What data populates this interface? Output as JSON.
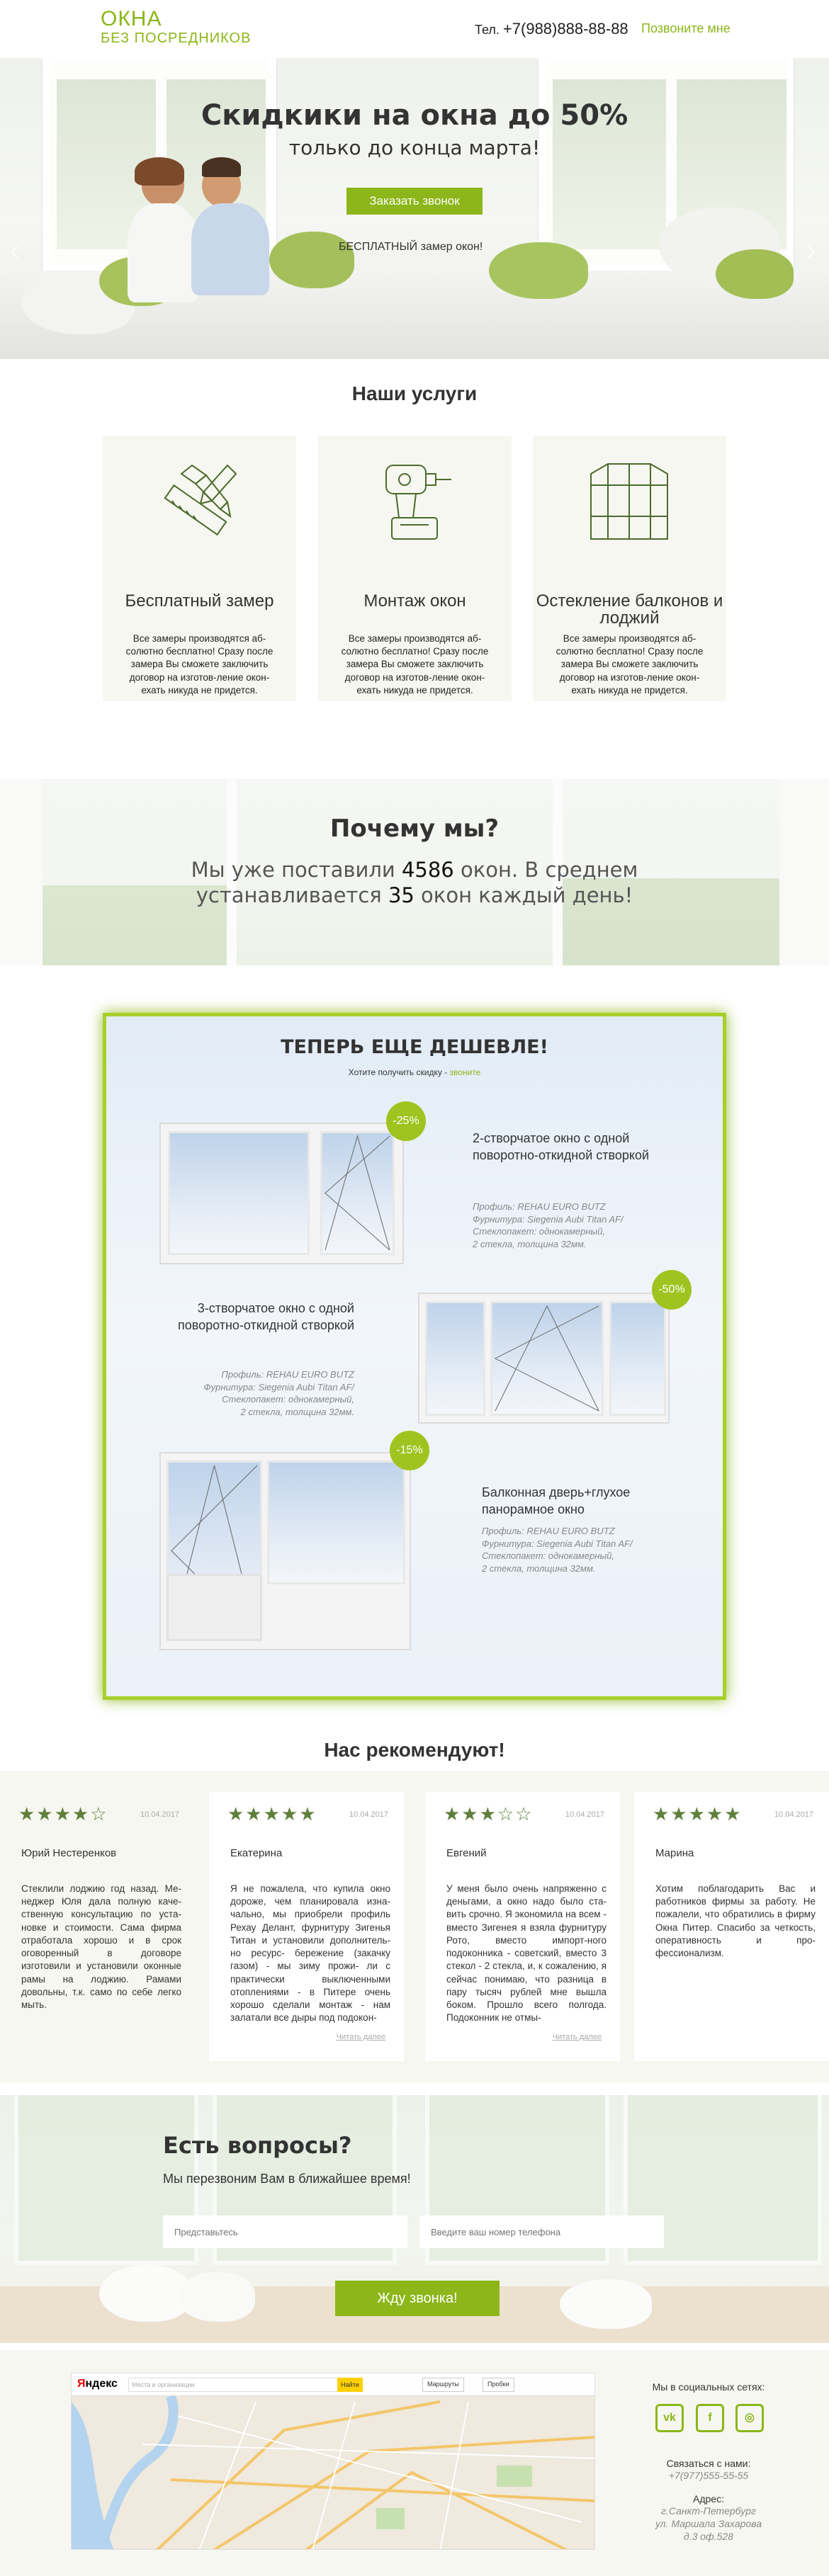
{
  "header": {
    "logo_line1": "ОКНА",
    "logo_line2": "БЕЗ ПОСРЕДНИКОВ",
    "phone_label": "Тел.",
    "phone_number": "+7(988)888-88-88",
    "callme_label": "Позвоните мне"
  },
  "hero": {
    "title": "Скидкики на окна до 50%",
    "subtitle": "только до конца марта!",
    "button_label": "Заказать звонок",
    "free_measure": "БЕСПЛАТНЫЙ замер окон!",
    "arrow_left": "‹",
    "arrow_right": "›"
  },
  "services": {
    "title": "Наши услуги",
    "items": [
      {
        "title": "Бесплатный замер",
        "desc": "Все замеры производятся аб-солютно бесплатно! Сразу после замера Вы сможете заключить договор на изготов-ление окон-ехать никуда не придется."
      },
      {
        "title": "Монтаж окон",
        "desc": "Все замеры производятся аб-солютно бесплатно! Сразу после замера Вы сможете заключить договор на изготов-ление окон-ехать никуда не придется."
      },
      {
        "title": "Остекление балконов и лоджий",
        "desc": "Все замеры производятся аб-солютно бесплатно! Сразу после замера Вы сможете заключить договор на изготов-ление окон-ехать никуда не придется."
      }
    ]
  },
  "why": {
    "title": "Почему мы?",
    "text_before": "Мы уже поставили ",
    "count_windows": "4586",
    "text_middle": " окон. В среднем устанавливается ",
    "per_day": "35",
    "text_after": " окон каждый день!"
  },
  "promo": {
    "title": "ТЕПЕРЬ ЕЩЕ ДЕШЕВЛЕ!",
    "sub_text": "Хотите получить скидку - ",
    "sub_link": "звоните",
    "windows": [
      {
        "discount": "-25%",
        "title": "2-створчатое окно с одной поворотно-откидной створкой",
        "spec": "Профиль: REHAU EURO BUTZ\nФурнитура: Siegenia Aubi Titan AF/\nСтеклопакет: однокамерный,\n2 стекла, толщина 32мм."
      },
      {
        "discount": "-50%",
        "title": "3-створчатое окно с одной поворотно-откидной створкой",
        "spec": "Профиль: REHAU EURO BUTZ\nФурнитура: Siegenia Aubi Titan AF/\nСтеклопакет: однокамерный,\n2 стекла, толщина 32мм."
      },
      {
        "discount": "-15%",
        "title": "Балконная дверь+глухое панорамное окно",
        "spec": "Профиль: REHAU EURO BUTZ\nФурнитура: Siegenia Aubi Titan AF/\nСтеклопакет: однокамерный,\n2 стекла, толщина 32мм."
      }
    ]
  },
  "reviews": {
    "title": "Нас рекомендуют!",
    "items": [
      {
        "rating": 4,
        "date": "10.04.2017",
        "name": "Юрий Нестеренков",
        "text": "Стеклили лоджию год назад. Ме-неджер Юля дала полную каче-ственную консультацию по уста-новке и стоимости. Сама фирма отработала хорошо и в срок оговоренный в договоре изготовили и установили оконные рамы на лоджию. Рамами довольны, т.к. само по себе легко мыть.",
        "more": ""
      },
      {
        "rating": 5,
        "date": "10.04.2017",
        "name": "Екатерина",
        "text": "Я не пожалела, что купила окно дороже, чем планировала изна-чально, мы приобрели профиль Рехау Делант, фурнитуру Зигенья Титан и установили дополнитель-но ресурс- бережение (закачку газом) - мы зиму прожи- ли с практически выключенными отоплениями - в Питере очень хорошо сделали монтаж - нам залатали все дыры под подокон-",
        "more": "Читать далее"
      },
      {
        "rating": 3,
        "date": "10.04.2017",
        "name": "Евгений",
        "text": "У меня было очень напряженно с деньгами, а окно надо было ста-вить срочно. Я экономила на всем - вместо Зигенея я взяла фурнитуру Рото, вместо импорт-ного подоконника - советский, вместо 3 стекол - 2 стекла, и, к сожалению, я сейчас понимаю, что разница в пару тысяч рублей мне вышла боком. Прошло всего полгода. Подоконник не отмы-",
        "more": "Читать далее"
      },
      {
        "rating": 5,
        "date": "10.04.2017",
        "name": "Марина",
        "text": "Хотим поблагодарить Вас и работников фирмы за работу. Не пожалели, что обратились в фирму Окна Питер. Спасибо за четкость, оперативность и про-фессионализм.",
        "more": ""
      }
    ]
  },
  "questions": {
    "title": "Есть вопросы?",
    "subtitle": "Мы перезвоним Вам в ближайшее время!",
    "name_placeholder": "Представьтесь",
    "phone_placeholder": "Введите ваш номер телефона",
    "button_label": "Жду звонка!"
  },
  "footer": {
    "map": {
      "brand_prefix": "Я",
      "brand_rest": "ндекс",
      "search_placeholder": "Места и организации",
      "find_label": "Найти",
      "routes_label": "Маршруты",
      "traffic_label": "Пробки"
    },
    "social_label": "Мы в социальных сетях:",
    "social": [
      {
        "icon": "vk-icon",
        "glyph": "vk"
      },
      {
        "icon": "facebook-icon",
        "glyph": "f"
      },
      {
        "icon": "instagram-icon",
        "glyph": "◎"
      }
    ],
    "contact_label": "Связаться с нами:",
    "contact_phone": "+7(977)555-55-55",
    "address_label": "Адрес:",
    "address_line1": "г.Санкт-Петербург",
    "address_line2": "ул. Маршала Захарова",
    "address_line3": "д.3 оф.528"
  },
  "colors": {
    "accent": "#8cb619",
    "star": "#5f7f3a",
    "panel": "#f7f7f1"
  }
}
